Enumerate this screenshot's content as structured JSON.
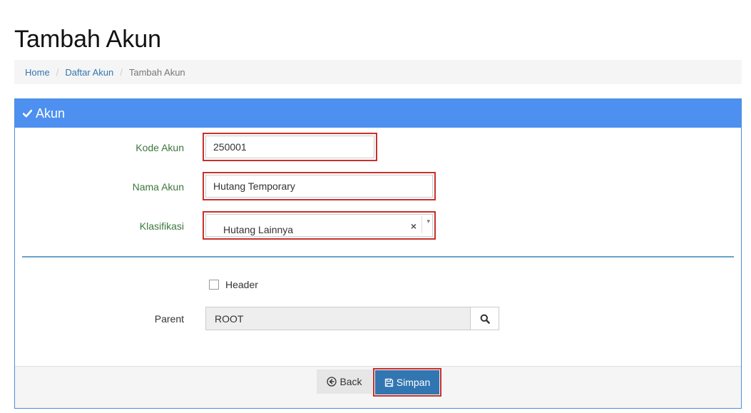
{
  "page": {
    "title": "Tambah Akun"
  },
  "breadcrumb": {
    "home": "Home",
    "list": "Daftar Akun",
    "current": "Tambah Akun",
    "separator": "/"
  },
  "panel": {
    "title": "Akun",
    "icon": "check-icon"
  },
  "form": {
    "kode_akun": {
      "label": "Kode Akun",
      "value": "250001"
    },
    "nama_akun": {
      "label": "Nama Akun",
      "value": "Hutang Temporary"
    },
    "klasifikasi": {
      "label": "Klasifikasi",
      "value": "Hutang Lainnya",
      "clear": "×",
      "arrow": "▾"
    },
    "header": {
      "label": "Header",
      "checked": false
    },
    "parent": {
      "label": "Parent",
      "value": "ROOT",
      "button_icon": "search-icon"
    }
  },
  "footer": {
    "back_label": "Back",
    "back_icon": "arrow-circle-left-icon",
    "save_label": "Simpan",
    "save_icon": "save-icon"
  },
  "colors": {
    "panel_heading": "#4d90f0",
    "label_green": "#3c763d",
    "highlight": "#c9302c",
    "save_button": "#3276b1",
    "link": "#3276b1"
  }
}
